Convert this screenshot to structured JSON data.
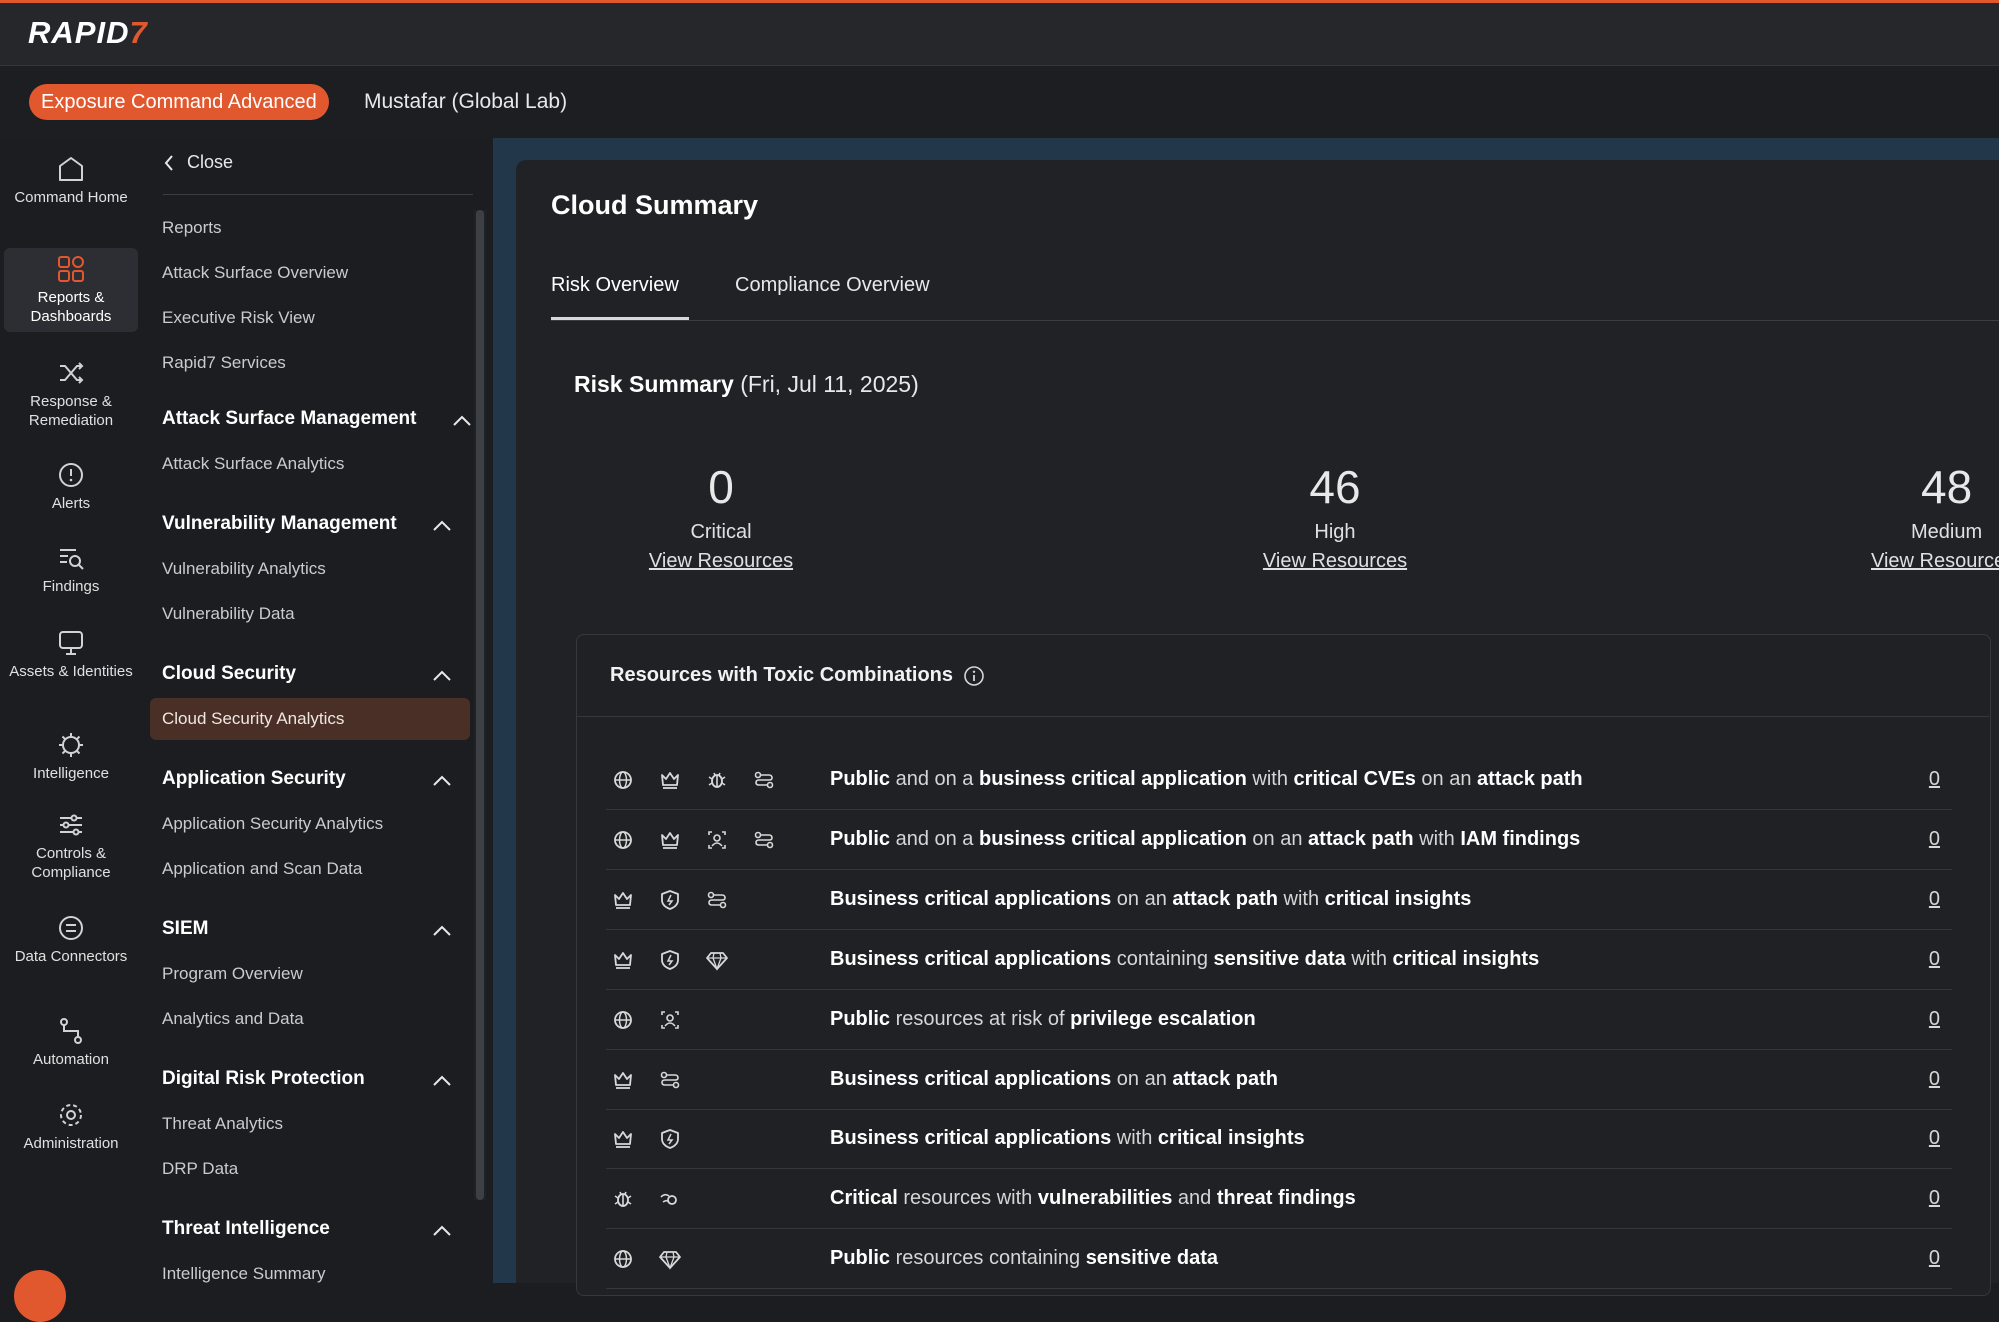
{
  "app": {
    "logo_main": "RAPID",
    "logo_suffix": "7",
    "product_badge": "Exposure Command Advanced",
    "org": "Mustafar (Global Lab)"
  },
  "rail": [
    {
      "label": "Command Home",
      "icon": "home-icon"
    },
    {
      "label": "Reports & Dashboards",
      "icon": "dashboard-icon",
      "active": true
    },
    {
      "label": "Response & Remediation",
      "icon": "shuffle-icon"
    },
    {
      "label": "Alerts",
      "icon": "alert-icon"
    },
    {
      "label": "Findings",
      "icon": "findings-icon"
    },
    {
      "label": "Assets & Identities",
      "icon": "monitor-icon"
    },
    {
      "label": "Intelligence",
      "icon": "virus-icon"
    },
    {
      "label": "Controls & Compliance",
      "icon": "sliders-icon"
    },
    {
      "label": "Data Connectors",
      "icon": "connector-icon"
    },
    {
      "label": "Automation",
      "icon": "workflow-icon"
    },
    {
      "label": "Administration",
      "icon": "gear-icon"
    }
  ],
  "subnav": {
    "close": "Close",
    "top_links": [
      "Reports",
      "Attack Surface Overview",
      "Executive Risk View",
      "Rapid7 Services"
    ],
    "sections": [
      {
        "title": "Attack Surface Management",
        "items": [
          "Attack Surface Analytics"
        ]
      },
      {
        "title": "Vulnerability Management",
        "items": [
          "Vulnerability Analytics",
          "Vulnerability Data"
        ]
      },
      {
        "title": "Cloud Security",
        "items": [
          "Cloud Security Analytics"
        ]
      },
      {
        "title": "Application Security",
        "items": [
          "Application Security Analytics",
          "Application and Scan Data"
        ]
      },
      {
        "title": "SIEM",
        "items": [
          "Program Overview",
          "Analytics and Data"
        ]
      },
      {
        "title": "Digital Risk Protection",
        "items": [
          "Threat Analytics",
          "DRP Data"
        ]
      },
      {
        "title": "Threat Intelligence",
        "items": [
          "Intelligence Summary"
        ]
      }
    ],
    "active_item": "Cloud Security Analytics"
  },
  "main": {
    "title": "Cloud Summary",
    "tabs": [
      "Risk Overview",
      "Compliance Overview"
    ],
    "active_tab": "Risk Overview",
    "risk_summary_label": "Risk Summary",
    "risk_summary_date": "(Fri, Jul 11, 2025)",
    "stats": [
      {
        "value": "0",
        "severity": "Critical",
        "link": "View Resources"
      },
      {
        "value": "46",
        "severity": "High",
        "link": "View Resources"
      },
      {
        "value": "48",
        "severity": "Medium",
        "link": "View Resources"
      }
    ],
    "toxic": {
      "title": "Resources with Toxic Combinations",
      "rows": [
        {
          "icons": [
            "globe-icon",
            "crown-icon",
            "bug-icon",
            "path-icon"
          ],
          "parts": [
            [
              "Public",
              1
            ],
            [
              " and on a ",
              0
            ],
            [
              "business critical application",
              1
            ],
            [
              " with ",
              0
            ],
            [
              "critical CVEs",
              1
            ],
            [
              " on an ",
              0
            ],
            [
              "attack path",
              1
            ]
          ],
          "count": "0"
        },
        {
          "icons": [
            "globe-icon",
            "crown-icon",
            "user-scan-icon",
            "path-icon"
          ],
          "parts": [
            [
              "Public",
              1
            ],
            [
              " and on a ",
              0
            ],
            [
              "business critical application",
              1
            ],
            [
              " on an ",
              0
            ],
            [
              "attack path",
              1
            ],
            [
              " with ",
              0
            ],
            [
              "IAM findings",
              1
            ]
          ],
          "count": "0"
        },
        {
          "icons": [
            "crown-icon",
            "shield-icon",
            "path-icon"
          ],
          "parts": [
            [
              "Business critical applications",
              1
            ],
            [
              " on an ",
              0
            ],
            [
              "attack path",
              1
            ],
            [
              " with ",
              0
            ],
            [
              "critical insights",
              1
            ]
          ],
          "count": "0"
        },
        {
          "icons": [
            "crown-icon",
            "shield-icon",
            "gem-icon"
          ],
          "parts": [
            [
              "Business critical applications",
              1
            ],
            [
              " containing ",
              0
            ],
            [
              "sensitive data",
              1
            ],
            [
              " with ",
              0
            ],
            [
              "critical insights",
              1
            ]
          ],
          "count": "0"
        },
        {
          "icons": [
            "globe-icon",
            "user-scan-icon"
          ],
          "parts": [
            [
              "Public",
              1
            ],
            [
              " resources at risk of ",
              0
            ],
            [
              "privilege escalation",
              1
            ]
          ],
          "count": "0"
        },
        {
          "icons": [
            "crown-icon",
            "path-icon"
          ],
          "parts": [
            [
              "Business critical applications",
              1
            ],
            [
              " on an ",
              0
            ],
            [
              "attack path",
              1
            ]
          ],
          "count": "0"
        },
        {
          "icons": [
            "crown-icon",
            "shield-icon"
          ],
          "parts": [
            [
              "Business critical applications",
              1
            ],
            [
              " with ",
              0
            ],
            [
              "critical insights",
              1
            ]
          ],
          "count": "0"
        },
        {
          "icons": [
            "bug-icon",
            "threat-icon"
          ],
          "parts": [
            [
              "Critical",
              1
            ],
            [
              " resources with ",
              0
            ],
            [
              "vulnerabilities",
              1
            ],
            [
              " and ",
              0
            ],
            [
              "threat findings",
              1
            ]
          ],
          "count": "0"
        },
        {
          "icons": [
            "globe-icon",
            "gem-icon"
          ],
          "parts": [
            [
              "Public",
              1
            ],
            [
              " resources containing ",
              0
            ],
            [
              "sensitive data",
              1
            ]
          ],
          "count": "0"
        }
      ]
    }
  },
  "colors": {
    "accent": "#e2582e",
    "active_nav_bg": "#4a2f26",
    "main_bg": "#202226"
  }
}
